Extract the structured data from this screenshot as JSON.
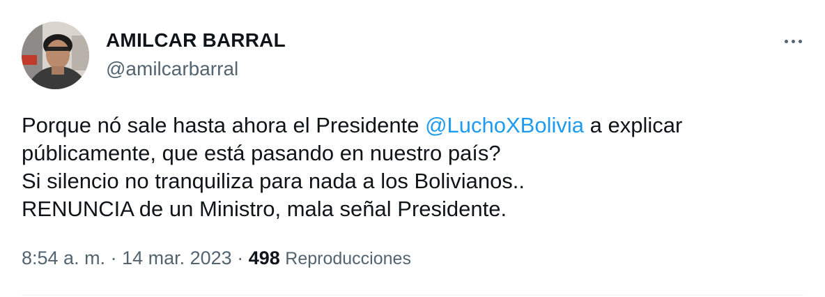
{
  "author": {
    "display_name": "AMILCAR BARRAL",
    "handle": "@amilcarbarral"
  },
  "tweet": {
    "line1_before": "Porque nó sale hasta ahora el Presidente ",
    "mention": "@LuchoXBolivia",
    "line1_after": " a explicar",
    "line2": "públicamente, que está pasando en nuestro país?",
    "line3": "Si silencio no tranquiliza para nada a los Bolivianos..",
    "line4": "RENUNCIA de un Ministro, mala señal Presidente."
  },
  "meta": {
    "time": "8:54 a. m.",
    "separator1": " · ",
    "date": "14 mar. 2023",
    "separator2": " · ",
    "views_count": "498",
    "views_label": "Reproducciones"
  },
  "icons": {
    "more": "more-horizontal-icon"
  },
  "colors": {
    "text_primary": "#0f1419",
    "text_secondary": "#536471",
    "link": "#1d9bf0",
    "divider": "#eff3f4"
  }
}
